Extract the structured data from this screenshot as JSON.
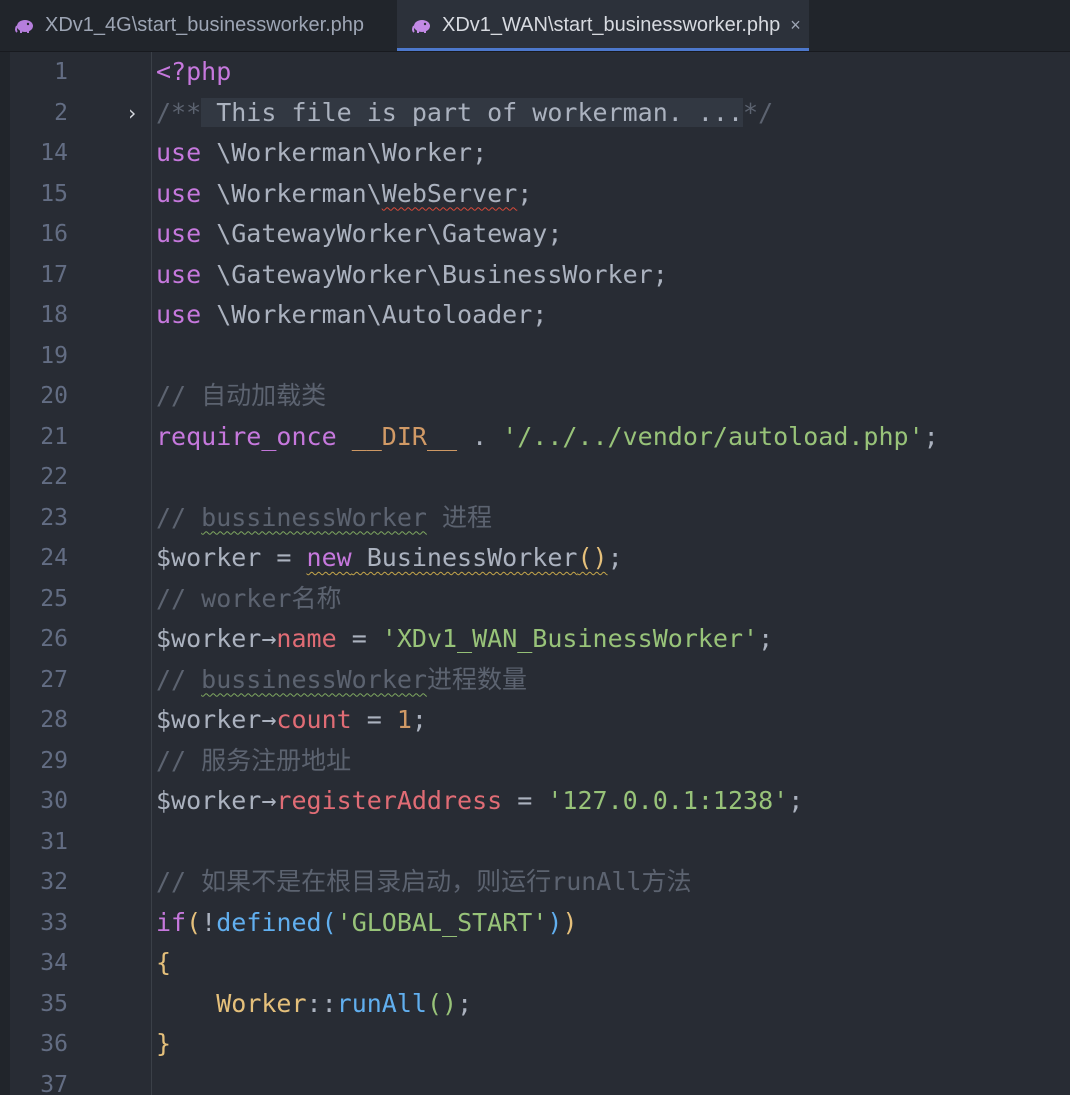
{
  "tabs": [
    {
      "label": "XDv1_4G\\start_businessworker.php",
      "active": false
    },
    {
      "label": "XDv1_WAN\\start_businessworker.php",
      "active": true,
      "close": "×"
    }
  ],
  "colors": {
    "background": "#282c34",
    "keyword": "#c678dd",
    "comment": "#5c6370",
    "string": "#98c379",
    "number": "#d19a66",
    "property": "#e06c75",
    "function": "#61afef",
    "class": "#e5c07b",
    "tab_accent": "#4d78cc"
  },
  "icons": {
    "file_type": "php-elephant-icon",
    "fold": "chevron-right-icon",
    "close": "close-icon"
  },
  "lines": [
    {
      "n": "1",
      "segs": [
        [
          "tag",
          "<?php"
        ]
      ]
    },
    {
      "n": "2",
      "fold": "›",
      "segs": [
        [
          "cmt",
          "/**"
        ],
        [
          "folded-box",
          " This file is part of workerman. ..."
        ],
        [
          "cmt",
          "*/"
        ]
      ]
    },
    {
      "n": "14",
      "segs": [
        [
          "kw",
          "use"
        ],
        [
          "punc",
          " \\Workerman\\Worker;"
        ]
      ]
    },
    {
      "n": "15",
      "segs": [
        [
          "kw",
          "use"
        ],
        [
          "punc",
          " \\Workerman\\"
        ],
        [
          "punc warn-red",
          "WebServer"
        ],
        [
          "punc",
          ";"
        ]
      ]
    },
    {
      "n": "16",
      "segs": [
        [
          "kw",
          "use"
        ],
        [
          "punc",
          " \\GatewayWorker\\Gateway;"
        ]
      ]
    },
    {
      "n": "17",
      "segs": [
        [
          "kw",
          "use"
        ],
        [
          "punc",
          " \\GatewayWorker\\BusinessWorker;"
        ]
      ]
    },
    {
      "n": "18",
      "segs": [
        [
          "kw",
          "use"
        ],
        [
          "punc",
          " \\Workerman\\Autoloader;"
        ]
      ]
    },
    {
      "n": "19",
      "segs": []
    },
    {
      "n": "20",
      "segs": [
        [
          "cmt",
          "// 自动加载类"
        ]
      ]
    },
    {
      "n": "21",
      "segs": [
        [
          "kw",
          "require_once"
        ],
        [
          "punc",
          " "
        ],
        [
          "const",
          "__DIR__"
        ],
        [
          "punc",
          " . "
        ],
        [
          "str",
          "'/../../vendor/autoload.php'"
        ],
        [
          "punc",
          ";"
        ]
      ]
    },
    {
      "n": "22",
      "segs": []
    },
    {
      "n": "23",
      "segs": [
        [
          "cmt",
          "// "
        ],
        [
          "cmt typo",
          "bussinessWorker"
        ],
        [
          "cmt",
          " 进程"
        ]
      ]
    },
    {
      "n": "24",
      "segs": [
        [
          "punc",
          "$worker = "
        ],
        [
          "kw warn-yel",
          "new"
        ],
        [
          "punc warn-yel",
          " BusinessWorker"
        ],
        [
          "brk warn-yel",
          "()"
        ],
        [
          "punc",
          ";"
        ]
      ]
    },
    {
      "n": "25",
      "segs": [
        [
          "cmt",
          "// worker名称"
        ]
      ]
    },
    {
      "n": "26",
      "segs": [
        [
          "punc",
          "$worker→"
        ],
        [
          "prop",
          "name"
        ],
        [
          "punc",
          " = "
        ],
        [
          "str",
          "'XDv1_WAN_BusinessWorker'"
        ],
        [
          "punc",
          ";"
        ]
      ]
    },
    {
      "n": "27",
      "segs": [
        [
          "cmt",
          "// "
        ],
        [
          "cmt typo",
          "bussinessWorker"
        ],
        [
          "cmt",
          "进程数量"
        ]
      ]
    },
    {
      "n": "28",
      "segs": [
        [
          "punc",
          "$worker→"
        ],
        [
          "prop",
          "count"
        ],
        [
          "punc",
          " = "
        ],
        [
          "num",
          "1"
        ],
        [
          "punc",
          ";"
        ]
      ]
    },
    {
      "n": "29",
      "segs": [
        [
          "cmt",
          "// 服务注册地址"
        ]
      ]
    },
    {
      "n": "30",
      "segs": [
        [
          "punc",
          "$worker→"
        ],
        [
          "prop",
          "registerAddress"
        ],
        [
          "punc",
          " = "
        ],
        [
          "str",
          "'127.0.0.1:1238'"
        ],
        [
          "punc",
          ";"
        ]
      ]
    },
    {
      "n": "31",
      "segs": []
    },
    {
      "n": "32",
      "segs": [
        [
          "cmt",
          "// 如果不是在根目录启动，则运行runAll方法"
        ]
      ]
    },
    {
      "n": "33",
      "segs": [
        [
          "kw",
          "if"
        ],
        [
          "brk",
          "("
        ],
        [
          "punc",
          "!"
        ],
        [
          "fn",
          "defined"
        ],
        [
          "fn",
          "("
        ],
        [
          "str",
          "'GLOBAL_START'"
        ],
        [
          "fn",
          ")"
        ],
        [
          "brk",
          ")"
        ]
      ]
    },
    {
      "n": "34",
      "segs": [
        [
          "brk",
          "{"
        ]
      ]
    },
    {
      "n": "35",
      "segs": [
        [
          "punc",
          "    "
        ],
        [
          "cls",
          "Worker"
        ],
        [
          "punc",
          "::"
        ],
        [
          "fn",
          "runAll"
        ],
        [
          "str",
          "()"
        ],
        [
          "punc",
          ";"
        ]
      ]
    },
    {
      "n": "36",
      "segs": [
        [
          "brk",
          "}"
        ]
      ]
    },
    {
      "n": "37",
      "segs": []
    }
  ]
}
